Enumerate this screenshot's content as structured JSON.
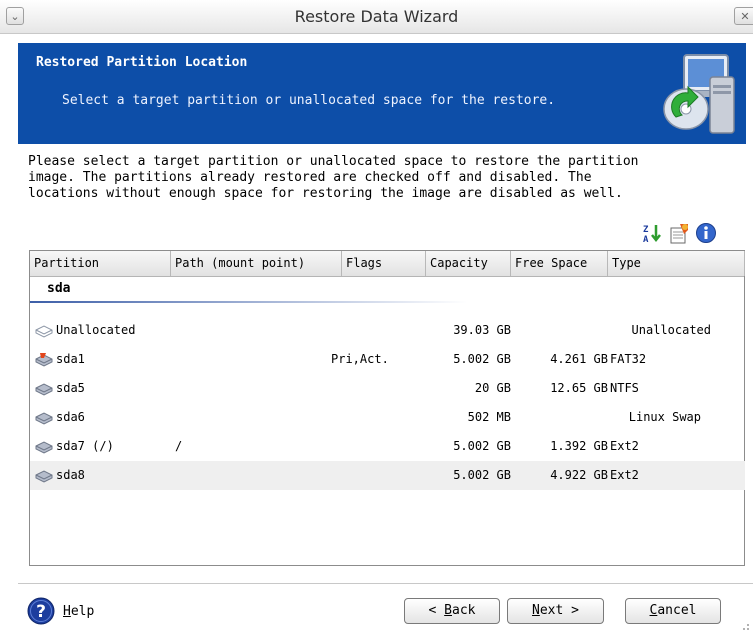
{
  "window": {
    "title": "Restore Data Wizard",
    "menu_glyph": "⌄",
    "close_glyph": "✕"
  },
  "header": {
    "title": "Restored Partition Location",
    "subtitle": "Select a target partition or unallocated space for the restore.",
    "icon": "restore-wizard-icon"
  },
  "instructions": "Please select a target partition or unallocated space to restore the partition\nimage. The partitions already restored are checked off and disabled. The\nlocations without enough space for restoring the image are disabled as well.",
  "toolbar": {
    "icons": [
      "sort-icon",
      "properties-icon",
      "info-icon"
    ]
  },
  "table": {
    "columns": {
      "partition": "Partition",
      "path": "Path (mount point)",
      "flags": "Flags",
      "capacity": "Capacity",
      "free": "Free Space",
      "type": "Type"
    },
    "group": "sda",
    "rows": [
      {
        "partition": "Unallocated",
        "path": "",
        "flags": "",
        "capacity": "39.03 GB",
        "free": "",
        "type": "Unallocated"
      },
      {
        "partition": "sda1",
        "path": "",
        "flags": "Pri,Act.",
        "capacity": "5.002 GB",
        "free": "4.261 GB",
        "type": "FAT32"
      },
      {
        "partition": "sda5",
        "path": "",
        "flags": "",
        "capacity": "20 GB",
        "free": "12.65 GB",
        "type": "NTFS"
      },
      {
        "partition": "sda6",
        "path": "",
        "flags": "",
        "capacity": "502 MB",
        "free": "",
        "type": "Linux Swap"
      },
      {
        "partition": "sda7 (/)",
        "path": "/",
        "flags": "",
        "capacity": "5.002 GB",
        "free": "1.392 GB",
        "type": "Ext2"
      },
      {
        "partition": "sda8",
        "path": "",
        "flags": "",
        "capacity": "5.002 GB",
        "free": "4.922 GB",
        "type": "Ext2"
      }
    ]
  },
  "footer": {
    "help": {
      "mnemonic": "H",
      "rest": "elp"
    },
    "back": {
      "prefix": "< ",
      "mnemonic": "B",
      "rest": "ack"
    },
    "next": {
      "mnemonic": "N",
      "rest": "ext >"
    },
    "cancel": {
      "mnemonic": "C",
      "rest": "ancel"
    }
  },
  "colors": {
    "banner": "#0d4ea8",
    "selected_row": "#efefef",
    "help_icon": "#1c3d9e"
  }
}
